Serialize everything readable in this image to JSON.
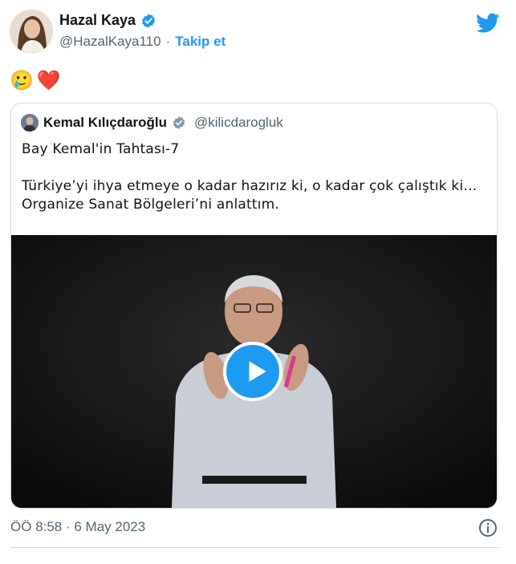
{
  "author": {
    "name": "Hazal Kaya",
    "handle": "@HazalKaya110",
    "separator": "·",
    "follow_label": "Takip et"
  },
  "tweet": {
    "emojis": [
      "🥲",
      "❤️"
    ],
    "timestamp": "ÖÖ 8:58 · 6 May 2023"
  },
  "quoted": {
    "name": "Kemal Kılıçdaroğlu",
    "handle": "@kilicdarogluk",
    "lines": [
      "Bay Kemal'in Tahtası-7",
      "",
      "Türkiye’yi ihya etmeye o kadar hazırız ki, o kadar çok çalıştık ki…",
      "Organize Sanat Bölgeleri’ni anlattım."
    ]
  },
  "colors": {
    "accent": "#1d9bf0",
    "verified_blue": "#1d9bf0",
    "verified_gray": "#829aab",
    "secondary_text": "#536471"
  },
  "icons": [
    "verified-badge-icon",
    "twitter-bird-icon",
    "play-icon",
    "info-icon"
  ]
}
